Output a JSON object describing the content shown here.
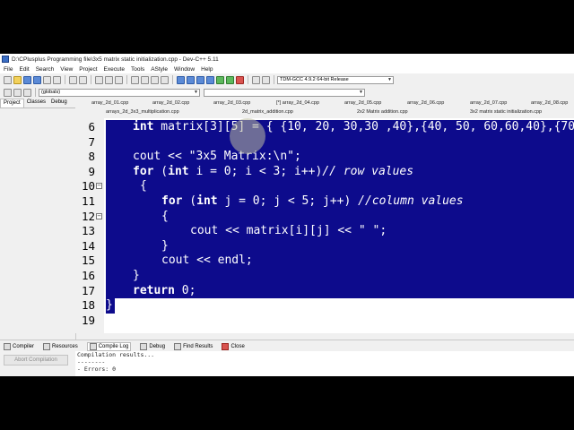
{
  "window": {
    "title": "D:\\CPlusplus Programming file\\3x5 matrix static initialization.cpp - Dev-C++ 5.11"
  },
  "menu": [
    "File",
    "Edit",
    "Search",
    "View",
    "Project",
    "Execute",
    "Tools",
    "AStyle",
    "Window",
    "Help"
  ],
  "toolbar": {
    "scope_combo": "(globals)",
    "compiler_combo": "TDM-GCC 4.9.2 64-bit Release"
  },
  "left_panel": {
    "tabs": [
      "Project",
      "Classes",
      "Debug"
    ]
  },
  "file_tabs": {
    "row1": [
      "array_2d_01.cpp",
      "array_2d_02.cpp",
      "array_2d_03.cpp",
      "[*] array_2d_04.cpp",
      "array_2d_05.cpp",
      "array_2d_06.cpp",
      "array_2d_07.cpp",
      "array_2d_08.cpp"
    ],
    "row2": [
      "arrays_2d_3x3_multiplication.cpp",
      "2d_matrix_addition.cpp",
      "2x2 Matrix addition.cpp",
      "3x2 matrix static initialization.cpp"
    ]
  },
  "editor": {
    "lines": [
      {
        "num": "6",
        "parts": [
          [
            "kw",
            "int"
          ],
          [
            "n",
            " matrix[3][5] = { {10, 20, 30,30 ,40},{40, 50, 60,60,40},{70"
          ]
        ]
      },
      {
        "num": "7",
        "parts": []
      },
      {
        "num": "8",
        "parts": [
          [
            "n",
            "cout << \"3x5 Matrix:\\n\";"
          ]
        ]
      },
      {
        "num": "9",
        "parts": [
          [
            "kw",
            "for"
          ],
          [
            "n",
            " ("
          ],
          [
            "kw",
            "int"
          ],
          [
            "n",
            " i = 0; i < 3; i++)"
          ],
          [
            "cm",
            "// row values"
          ]
        ]
      },
      {
        "num": "10",
        "parts": [
          [
            "n",
            "{"
          ]
        ]
      },
      {
        "num": "11",
        "parts": [
          [
            "kw",
            "for"
          ],
          [
            "n",
            " ("
          ],
          [
            "kw",
            "int"
          ],
          [
            "n",
            " j = 0; j < 5; j++) "
          ],
          [
            "cm",
            "//column values"
          ]
        ]
      },
      {
        "num": "12",
        "parts": [
          [
            "n",
            "{"
          ]
        ]
      },
      {
        "num": "13",
        "parts": [
          [
            "n",
            "cout << matrix[i][j] << \" \";"
          ]
        ]
      },
      {
        "num": "14",
        "parts": [
          [
            "n",
            "}"
          ]
        ]
      },
      {
        "num": "15",
        "parts": [
          [
            "n",
            "cout << endl;"
          ]
        ]
      },
      {
        "num": "16",
        "parts": [
          [
            "n",
            "}"
          ]
        ]
      },
      {
        "num": "17",
        "parts": [
          [
            "kw",
            "return"
          ],
          [
            "n",
            " 0;"
          ]
        ]
      },
      {
        "num": "18",
        "parts": [
          [
            "n",
            "}"
          ]
        ]
      },
      {
        "num": "19",
        "parts": []
      }
    ]
  },
  "bottom_tabs": [
    "Compiler",
    "Resources",
    "Compile Log",
    "Debug",
    "Find Results",
    "Close"
  ],
  "bottom_panel": {
    "abort_label": "Abort Compilation",
    "log": [
      "Compilation results...",
      "--------",
      "- Errors: 0"
    ]
  },
  "colors": {
    "selection": "#0d0b8c",
    "editor_bg": "#ffffff",
    "chrome": "#f0f0f0"
  }
}
